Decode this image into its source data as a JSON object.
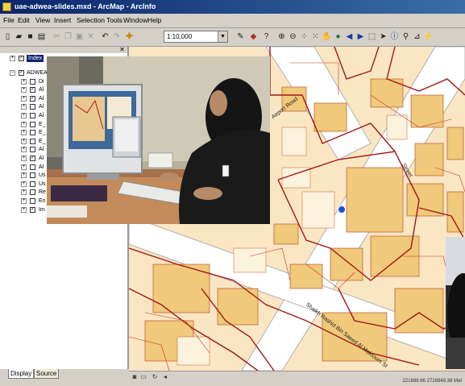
{
  "window": {
    "title": "uae-adwea-slides.mxd - ArcMap - ArcInfo"
  },
  "menu": [
    "File",
    "Edit",
    "View",
    "Insert",
    "Selection",
    "Tools",
    "Window",
    "Help"
  ],
  "toolbar": {
    "scale": "1:10,000",
    "icons": [
      "new-icon",
      "open-icon",
      "save-icon",
      "print-icon",
      "cut-icon",
      "copy-icon",
      "paste-icon",
      "delete-icon",
      "undo-icon",
      "redo-icon",
      "add-data-icon",
      "editor-icon",
      "arc-toolbox-icon",
      "whats-this-icon",
      "zoom-in-icon",
      "zoom-out-icon",
      "fixed-zoom-in-icon",
      "fixed-zoom-out-icon",
      "pan-icon",
      "full-extent-icon",
      "back-extent-icon",
      "forward-extent-icon",
      "select-features-icon",
      "select-elements-icon",
      "identify-icon",
      "find-icon",
      "measure-icon",
      "hyperlink-icon"
    ]
  },
  "toc": {
    "layers": [
      {
        "name": "Index",
        "checked": true,
        "expanded": false,
        "top": true
      },
      {
        "name": "ADWEA",
        "checked": true,
        "expanded": true
      },
      {
        "name": "Di",
        "checked": false
      },
      {
        "name": "Al",
        "checked": true
      },
      {
        "name": "Al",
        "checked": true
      },
      {
        "name": "Al",
        "checked": false
      },
      {
        "name": "Al",
        "checked": false
      },
      {
        "name": "E_",
        "checked": false
      },
      {
        "name": "E_",
        "checked": false
      },
      {
        "name": "E_",
        "checked": false
      },
      {
        "name": "Al",
        "checked": false
      },
      {
        "name": "Al",
        "checked": true
      },
      {
        "name": "Al",
        "checked": false
      },
      {
        "name": "Us",
        "checked": false
      },
      {
        "name": "Us",
        "checked": false
      },
      {
        "name": "Re",
        "checked": false
      },
      {
        "name": "En",
        "checked": false
      },
      {
        "name": "Im",
        "checked": true
      }
    ],
    "tabs": [
      "Display",
      "Source"
    ]
  },
  "map": {
    "street_labels": [
      "Shaikh Rashid Bin Saeed Al Maktoum St",
      "Airport Road",
      "Street"
    ],
    "colors": {
      "background": "#fae6c2",
      "parcels": "#a01818",
      "roads": "#ffffff",
      "buildings": "#f0c97a"
    }
  },
  "status": {
    "coordinates": "221688.66  2728849.38 Met"
  }
}
